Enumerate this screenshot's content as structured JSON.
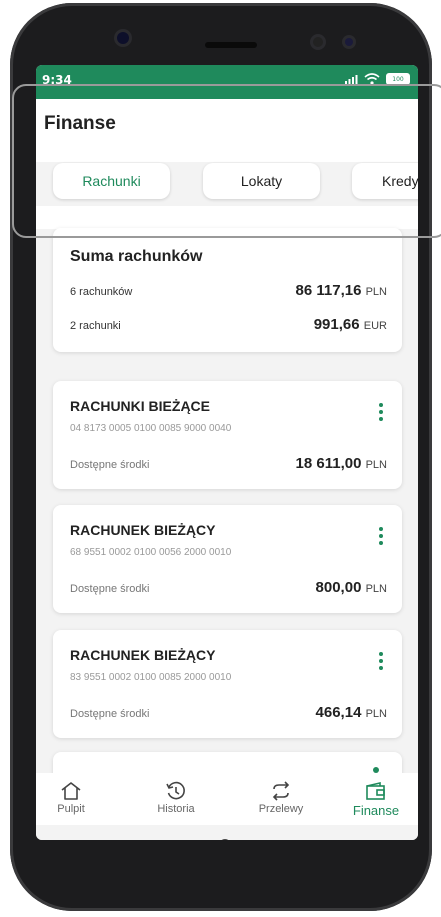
{
  "status_bar": {
    "time": "9:34",
    "battery": "100"
  },
  "header": {
    "title": "Finanse"
  },
  "tabs": [
    {
      "label": "Rachunki",
      "active": true
    },
    {
      "label": "Lokaty",
      "active": false
    },
    {
      "label": "Kredy",
      "active": false
    }
  ],
  "summary": {
    "title": "Suma rachunków",
    "rows": [
      {
        "label": "6 rachunków",
        "amount": "86 117,16",
        "currency": "PLN"
      },
      {
        "label": "2 rachunki",
        "amount": "991,66",
        "currency": "EUR"
      }
    ]
  },
  "accounts": [
    {
      "name": "RACHUNKI BIEŻĄCE",
      "number": "04 8173 0005 0100 0085 9000 0040",
      "available_label": "Dostępne środki",
      "amount": "18 611,00",
      "currency": "PLN"
    },
    {
      "name": "RACHUNEK BIEŻĄCY",
      "number": "68 9551 0002 0100 0056 2000 0010",
      "available_label": "Dostępne środki",
      "amount": "800,00",
      "currency": "PLN"
    },
    {
      "name": "RACHUNEK BIEŻĄCY",
      "number": "83 9551 0002 0100 0085 2000 0010",
      "available_label": "Dostępne środki",
      "amount": "466,14",
      "currency": "PLN"
    }
  ],
  "bottom_nav": [
    {
      "label": "Pulpit",
      "icon": "home-icon",
      "active": false
    },
    {
      "label": "Historia",
      "icon": "history-icon",
      "active": false
    },
    {
      "label": "Przelewy",
      "icon": "transfer-icon",
      "active": false
    },
    {
      "label": "Finanse",
      "icon": "wallet-icon",
      "active": true
    }
  ],
  "colors": {
    "accent": "#1f8a5c",
    "background": "#f3f3f3"
  }
}
